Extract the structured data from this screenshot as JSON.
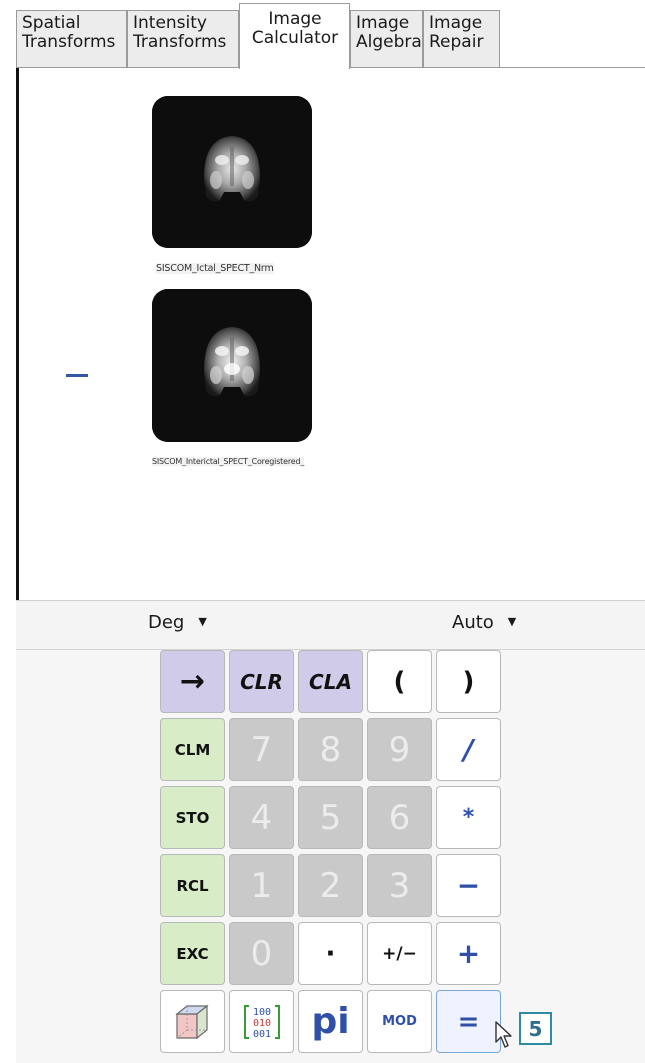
{
  "tabs": [
    {
      "label": "Spatial Transforms"
    },
    {
      "label": "Intensity Transforms"
    },
    {
      "label": "Image Calculator"
    },
    {
      "label": "Image Algebra"
    },
    {
      "label": "Image Repair"
    }
  ],
  "active_tab": "Image Calculator",
  "images": [
    {
      "caption": "SISCOM_Ictal_SPECT_Nrm"
    },
    {
      "caption": "SISCOM_Interictal_SPECT_Coregistered_"
    }
  ],
  "operator": "−",
  "modes": {
    "angle": "Deg",
    "format": "Auto"
  },
  "keypad": {
    "store": "→",
    "clr": "CLR",
    "cla": "CLA",
    "lparen": "(",
    "rparen": ")",
    "clm": "CLM",
    "sto": "STO",
    "rcl": "RCL",
    "exc": "EXC",
    "d7": "7",
    "d8": "8",
    "d9": "9",
    "d4": "4",
    "d5": "5",
    "d6": "6",
    "d1": "1",
    "d2": "2",
    "d3": "3",
    "d0": "0",
    "dot": "·",
    "sign": "+/−",
    "divide": "/",
    "multiply": "*",
    "subtract": "−",
    "add": "+",
    "matrix": "100 010 001",
    "pi": "pi",
    "mod": "MOD",
    "equals": "="
  },
  "step_badge": "5",
  "icons": {
    "cube": "3d-cube-icon",
    "matrix": "identity-matrix-icon",
    "cursor": "mouse-pointer-icon",
    "mode_arrow": "dropdown-arrow-icon"
  },
  "colors": {
    "operator_blue": "#2f4fa8",
    "memory_green": "#d8ecc8",
    "clear_purple": "#cfcbe8",
    "disabled_gray": "#c9c9c9",
    "badge_teal": "#2e8aa6"
  }
}
